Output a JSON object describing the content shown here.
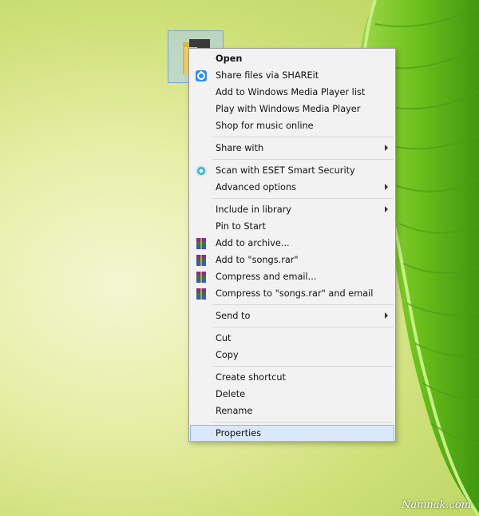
{
  "colors": {
    "menu_bg": "#f2f2f2",
    "menu_border": "#9b9b9b",
    "highlight_bg": "#dae8fb",
    "highlight_border": "#8fb8ea",
    "leaf_green": "#6fbf1f"
  },
  "context_menu": {
    "groups": [
      [
        {
          "label": "Open",
          "bold": true,
          "icon": null,
          "submenu": false
        },
        {
          "label": "Share files via SHAREit",
          "icon": "shareit-icon",
          "submenu": false
        },
        {
          "label": "Add to Windows Media Player list",
          "icon": null,
          "submenu": false
        },
        {
          "label": "Play with Windows Media Player",
          "icon": null,
          "submenu": false
        },
        {
          "label": "Shop for music online",
          "icon": null,
          "submenu": false
        }
      ],
      [
        {
          "label": "Share with",
          "icon": null,
          "submenu": true
        }
      ],
      [
        {
          "label": "Scan with ESET Smart Security",
          "icon": "eset-icon",
          "submenu": false
        },
        {
          "label": "Advanced options",
          "icon": null,
          "submenu": true
        }
      ],
      [
        {
          "label": "Include in library",
          "icon": null,
          "submenu": true
        },
        {
          "label": "Pin to Start",
          "icon": null,
          "submenu": false
        },
        {
          "label": "Add to archive...",
          "icon": "winrar-icon",
          "submenu": false
        },
        {
          "label": "Add to \"songs.rar\"",
          "icon": "winrar-icon",
          "submenu": false
        },
        {
          "label": "Compress and email...",
          "icon": "winrar-icon",
          "submenu": false
        },
        {
          "label": "Compress to \"songs.rar\" and email",
          "icon": "winrar-icon",
          "submenu": false
        }
      ],
      [
        {
          "label": "Send to",
          "icon": null,
          "submenu": true
        }
      ],
      [
        {
          "label": "Cut",
          "icon": null,
          "submenu": false
        },
        {
          "label": "Copy",
          "icon": null,
          "submenu": false
        }
      ],
      [
        {
          "label": "Create shortcut",
          "icon": null,
          "submenu": false
        },
        {
          "label": "Delete",
          "icon": null,
          "submenu": false
        },
        {
          "label": "Rename",
          "icon": null,
          "submenu": false
        }
      ],
      [
        {
          "label": "Properties",
          "icon": null,
          "submenu": false,
          "highlighted": true
        }
      ]
    ]
  },
  "watermark": "Namnak.com"
}
